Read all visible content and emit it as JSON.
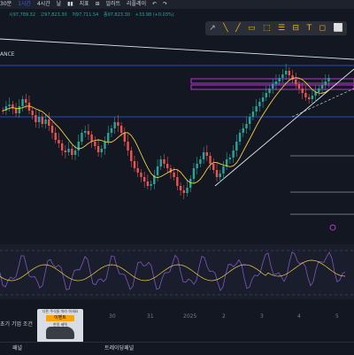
{
  "toolbar": {
    "interval_30m": "30분",
    "interval_1h": "1시간",
    "interval_4h": "4시간",
    "interval_day": "날",
    "indicators": "지표",
    "alerts": "얼러트",
    "replay": "리플레이"
  },
  "symbol_fragment": "ANCE",
  "ohlc": {
    "open": "시97,789.32",
    "high": "고97,823.30",
    "low": "저97,711.54",
    "close": "종97,823.30",
    "change": "+33.98 (+0.03%)"
  },
  "drawing_tools": [
    "↗",
    "╲",
    "╱",
    "▭",
    "⬚",
    "☰",
    "⊟",
    "T",
    "◻",
    "⬜"
  ],
  "xaxis_labels": [
    "30",
    "31",
    "2025",
    "2",
    "3",
    "4",
    "5"
  ],
  "promo_caption": "초기 기업 조건",
  "ad": {
    "title": "다른 주식들 따라 하세요",
    "badge": "이벤트",
    "text": "한정 혜택"
  },
  "bottom_tabs": {
    "panel": "패널",
    "trading_panel": "트레이딩패널"
  },
  "colors": {
    "background": "#131722",
    "up": "#26a69a",
    "down": "#ef5350",
    "ma": "#f0d040",
    "rsi": "#7e57c2",
    "hline": "#2962ff",
    "zone": "#e040fb"
  }
}
